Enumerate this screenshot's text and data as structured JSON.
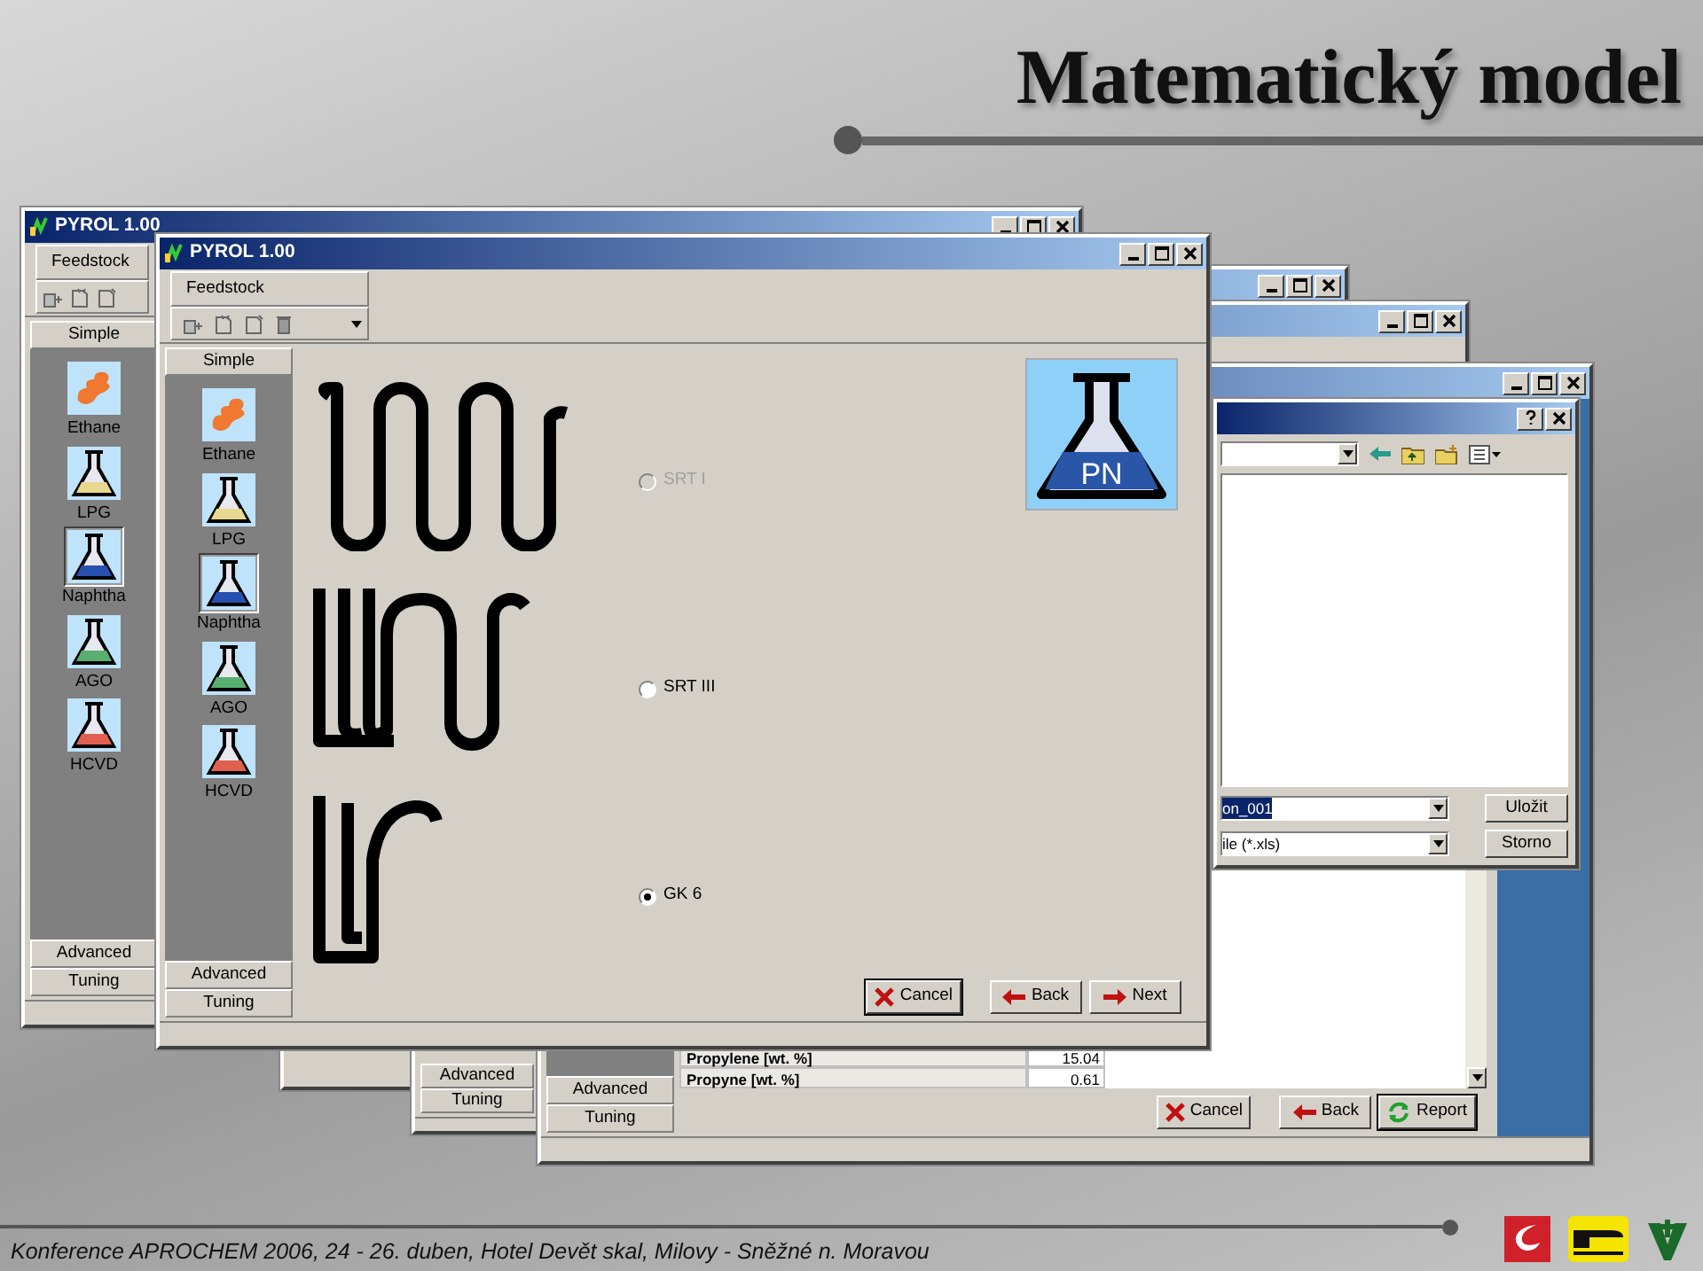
{
  "slide": {
    "title": "Matematický model",
    "footer": "Konference APROCHEM 2006, 24 - 26. duben, Hotel Devět skal, Milovy - Sněžné n. Moravou"
  },
  "back_window": {
    "title": "PYROL 1.00",
    "tab": "Feedstock",
    "sidebar_header": "Simple",
    "feedstocks": [
      {
        "label": "Ethane",
        "kind": "flame",
        "color": "#f07830",
        "selected": false
      },
      {
        "label": "LPG",
        "kind": "flask",
        "color": "#e8d890",
        "selected": false
      },
      {
        "label": "Naphtha",
        "kind": "flask",
        "color": "#2850b0",
        "selected": true
      },
      {
        "label": "AGO",
        "kind": "flask",
        "color": "#58b070",
        "selected": false
      },
      {
        "label": "HCVD",
        "kind": "flask",
        "color": "#e06050",
        "selected": false
      }
    ],
    "sidebar_footer": [
      "Advanced",
      "Tuning"
    ]
  },
  "front_window": {
    "title": "PYROL 1.00",
    "tab": "Feedstock",
    "sidebar_header": "Simple",
    "feedstocks": [
      {
        "label": "Ethane",
        "kind": "flame",
        "color": "#f07830",
        "selected": false
      },
      {
        "label": "LPG",
        "kind": "flask",
        "color": "#e8d890",
        "selected": false
      },
      {
        "label": "Naphtha",
        "kind": "flask",
        "color": "#2850b0",
        "selected": true
      },
      {
        "label": "AGO",
        "kind": "flask",
        "color": "#58b070",
        "selected": false
      },
      {
        "label": "HCVD",
        "kind": "flask",
        "color": "#e06050",
        "selected": false
      }
    ],
    "sidebar_footer": [
      "Advanced",
      "Tuning"
    ],
    "coils": [
      {
        "label": "SRT I",
        "kind": "serpentine",
        "selected": false,
        "disabled": true
      },
      {
        "label": "SRT III",
        "kind": "split",
        "selected": false,
        "disabled": false
      },
      {
        "label": "GK 6",
        "kind": "u-tube",
        "selected": true,
        "disabled": false
      }
    ],
    "badge": "PN",
    "buttons": [
      {
        "label": "Cancel",
        "kind": "cancel",
        "default": true
      },
      {
        "label": "Back",
        "kind": "back",
        "default": false
      },
      {
        "label": "Next",
        "kind": "next",
        "default": false
      }
    ]
  },
  "middle_window": {
    "sidebar_footer": [
      "Advanced",
      "Tuning"
    ]
  },
  "report_window": {
    "sidebar_footer": [
      "Advanced",
      "Tuning"
    ],
    "rows": [
      {
        "name": "Propylene [wt. %]",
        "value": "15.04"
      },
      {
        "name": "Propyne [wt. %]",
        "value": "0.61"
      }
    ],
    "buttons": [
      {
        "label": "Cancel",
        "kind": "cancel",
        "default": false
      },
      {
        "label": "Back",
        "kind": "back",
        "default": false
      },
      {
        "label": "Report",
        "kind": "refresh",
        "default": true
      }
    ]
  },
  "save_dialog": {
    "file_name": "on_001",
    "file_type": "ile (*.xls)",
    "buttons": [
      "Uložit",
      "Storno"
    ]
  }
}
